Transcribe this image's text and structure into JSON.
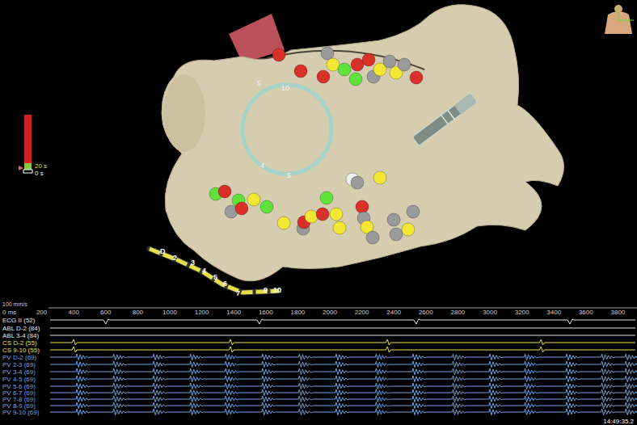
{
  "view3d": {
    "scale_bar": {
      "max": "20 s",
      "min": "0 s"
    },
    "ablation_points": [
      {
        "color": "#d9302a"
      },
      {
        "color": "#d9302a"
      },
      {
        "color": "#d9302a"
      },
      {
        "color": "#9a9a9a"
      },
      {
        "color": "#f2e833"
      },
      {
        "color": "#5fe33a"
      },
      {
        "color": "#5fe33a"
      },
      {
        "color": "#d9302a"
      },
      {
        "color": "#d9302a"
      },
      {
        "color": "#9a9a9a"
      },
      {
        "color": "#f2e833"
      },
      {
        "color": "#9a9a9a"
      },
      {
        "color": "#f2e833"
      },
      {
        "color": "#9a9a9a"
      },
      {
        "color": "#d9302a"
      },
      {
        "color": "#f0f0f0"
      },
      {
        "color": "#9a9a9a"
      },
      {
        "color": "#f2e833"
      },
      {
        "color": "#5fe33a"
      },
      {
        "color": "#d9302a"
      },
      {
        "color": "#9a9a9a"
      },
      {
        "color": "#5fe33a"
      },
      {
        "color": "#d9302a"
      },
      {
        "color": "#f2e833"
      },
      {
        "color": "#5fe33a"
      },
      {
        "color": "#f2e833"
      },
      {
        "color": "#9a9a9a"
      },
      {
        "color": "#d9302a"
      },
      {
        "color": "#f2e833"
      },
      {
        "color": "#d9302a"
      },
      {
        "color": "#5fe33a"
      },
      {
        "color": "#f2e833"
      },
      {
        "color": "#f2e833"
      },
      {
        "color": "#d9302a"
      },
      {
        "color": "#9a9a9a"
      },
      {
        "color": "#f2e833"
      },
      {
        "color": "#9a9a9a"
      },
      {
        "color": "#9a9a9a"
      },
      {
        "color": "#9a9a9a"
      },
      {
        "color": "#f2e833"
      },
      {
        "color": "#9a9a9a"
      }
    ],
    "lasso_labels": [
      "10",
      "5",
      "5",
      "4"
    ],
    "cs_labels": [
      "D",
      "2",
      "3",
      "4",
      "5",
      "6",
      "7",
      "9",
      "10"
    ]
  },
  "traces": {
    "speed": "100 mm/s",
    "axis_ticks": [
      "0 ms",
      "200",
      "400",
      "600",
      "800",
      "1000",
      "1200",
      "1400",
      "1600",
      "1800",
      "2000",
      "2200",
      "2400",
      "2600",
      "2800",
      "3000",
      "3200",
      "3400",
      "3600",
      "3800"
    ],
    "channels": [
      {
        "label": "ECG II (52)",
        "color": "#e6e6e6",
        "kind": "ecg",
        "events_ms": [
          600,
          1560,
          2540,
          3500
        ]
      },
      {
        "label": "ABL D-2 (84)",
        "color": "#e6e6e6",
        "kind": "flat",
        "events_ms": []
      },
      {
        "label": "ABL 3-4 (84)",
        "color": "#e6e6e6",
        "kind": "flat",
        "events_ms": []
      },
      {
        "label": "CS D-2 (55)",
        "color": "#e8e04a",
        "kind": "cs",
        "events_ms": [
          400,
          1380,
          2360,
          3320
        ]
      },
      {
        "label": "CS 9-10 (55)",
        "color": "#e8e04a",
        "kind": "cs",
        "events_ms": [
          400,
          1380,
          2360,
          3320
        ]
      },
      {
        "label": "PV D-2 (69)",
        "color": "#6fa3e0",
        "kind": "pv",
        "events_ms": [
          420,
          650,
          900,
          1130,
          1350,
          1580,
          1810,
          2040,
          2290,
          2520,
          2770,
          3000,
          3220,
          3480,
          3700,
          3850
        ]
      },
      {
        "label": "PV 2-3 (69)",
        "color": "#6fa3e0",
        "kind": "pv",
        "events_ms": [
          420,
          650,
          900,
          1130,
          1350,
          1580,
          1810,
          2040,
          2290,
          2520,
          2770,
          3000,
          3220,
          3480,
          3700,
          3850
        ]
      },
      {
        "label": "PV 3-4 (69)",
        "color": "#6fa3e0",
        "kind": "pv",
        "events_ms": [
          420,
          650,
          900,
          1130,
          1350,
          1580,
          1810,
          2040,
          2290,
          2520,
          2770,
          3000,
          3220,
          3480,
          3700,
          3850
        ]
      },
      {
        "label": "PV 4-5 (69)",
        "color": "#6fa3e0",
        "kind": "pv",
        "events_ms": [
          420,
          650,
          900,
          1130,
          1350,
          1580,
          1810,
          2040,
          2290,
          2520,
          2770,
          3000,
          3220,
          3480,
          3700,
          3850
        ]
      },
      {
        "label": "PV 5-6 (69)",
        "color": "#6fa3e0",
        "kind": "pv",
        "events_ms": [
          420,
          650,
          900,
          1130,
          1350,
          1580,
          1810,
          2040,
          2290,
          2520,
          2770,
          3000,
          3220,
          3480,
          3700,
          3850
        ]
      },
      {
        "label": "PV 6-7 (69)",
        "color": "#6fa3e0",
        "kind": "pv",
        "events_ms": [
          420,
          650,
          900,
          1130,
          1350,
          1580,
          1810,
          2040,
          2290,
          2520,
          2770,
          3000,
          3220,
          3480,
          3700,
          3850
        ]
      },
      {
        "label": "PV 7-8 (69)",
        "color": "#6fa3e0",
        "kind": "pv",
        "events_ms": [
          420,
          650,
          900,
          1130,
          1350,
          1580,
          1810,
          2040,
          2290,
          2520,
          2770,
          3000,
          3220,
          3480,
          3700,
          3850
        ]
      },
      {
        "label": "PV 8-9 (69)",
        "color": "#6fa3e0",
        "kind": "pv",
        "events_ms": [
          420,
          650,
          900,
          1130,
          1350,
          1580,
          1810,
          2040,
          2290,
          2520,
          2770,
          3000,
          3220,
          3480,
          3700,
          3850
        ]
      },
      {
        "label": "PV 9-10 (69)",
        "color": "#6fa3e0",
        "kind": "pv",
        "events_ms": [
          420,
          650,
          900,
          1130,
          1350,
          1580,
          1810,
          2040,
          2290,
          2520,
          2770,
          3000,
          3220,
          3480,
          3700,
          3850
        ]
      }
    ]
  },
  "timestamp": "14:49:35.2"
}
